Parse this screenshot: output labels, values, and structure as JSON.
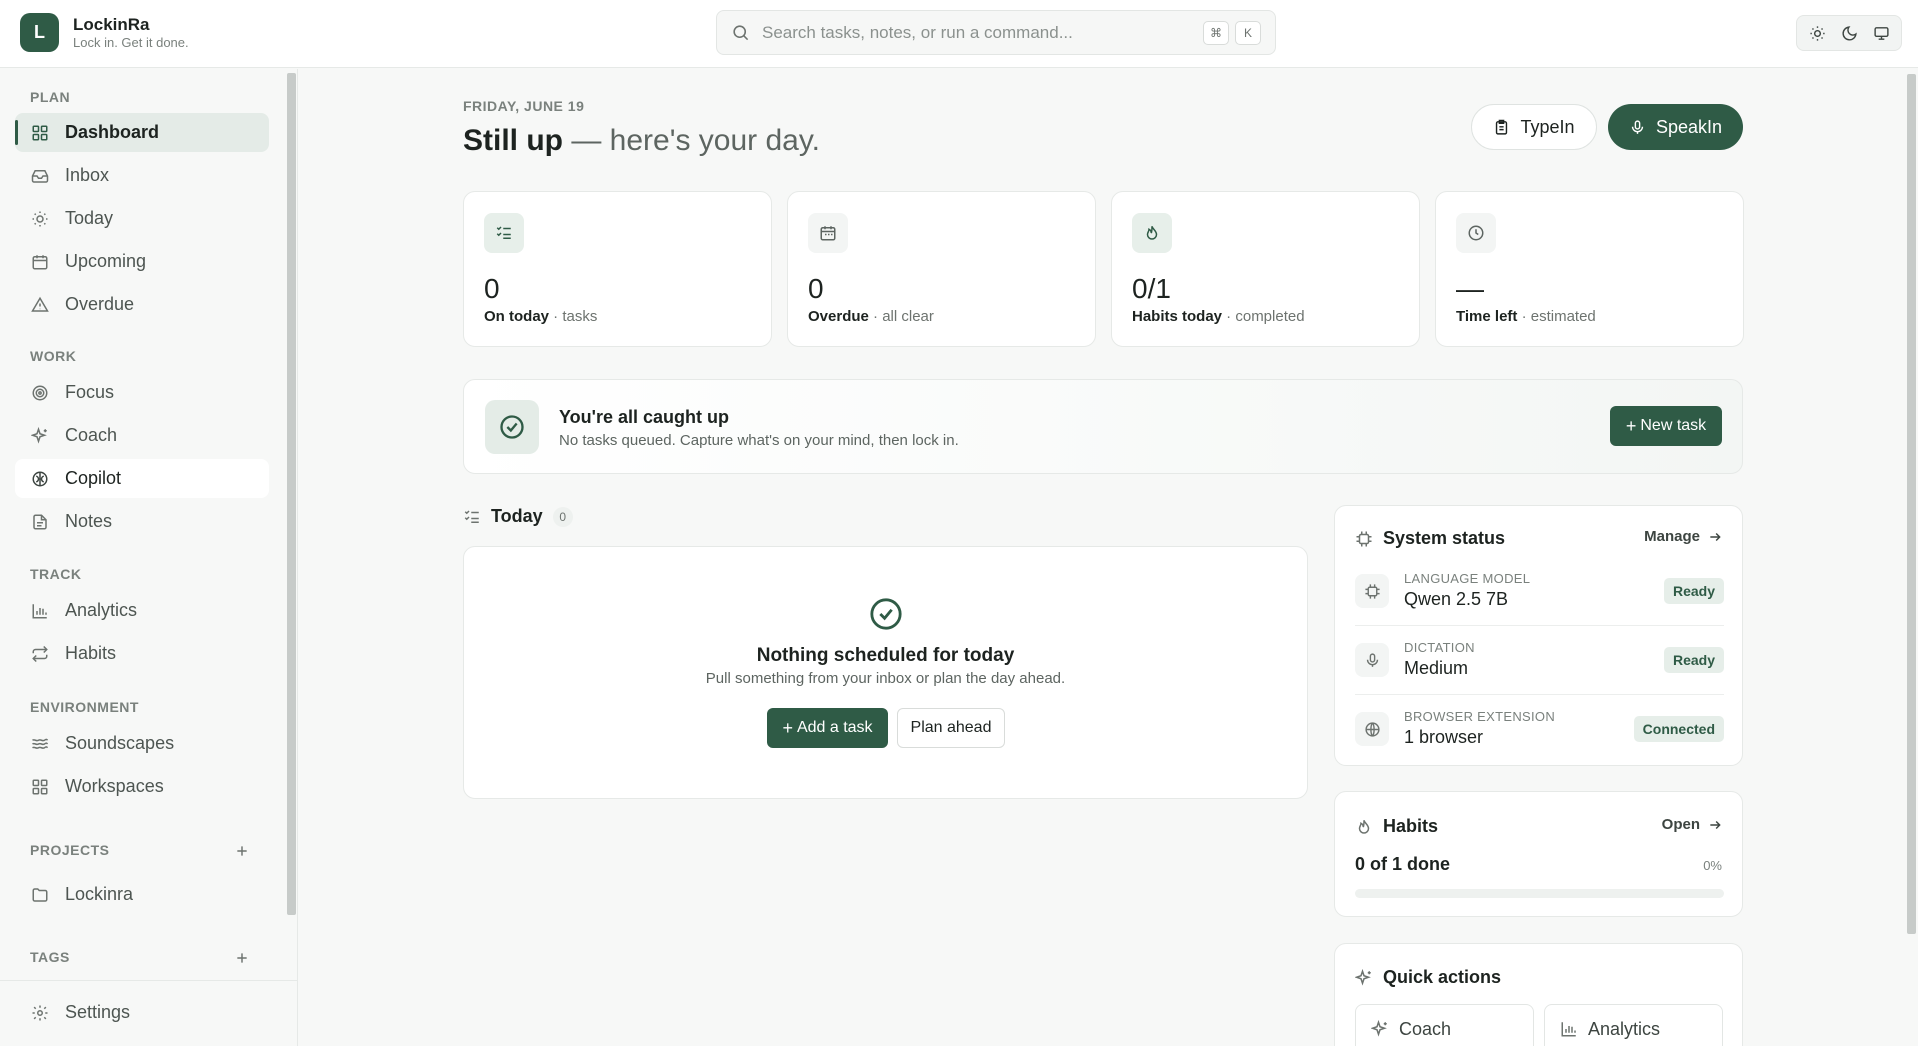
{
  "brand": {
    "logo_letter": "L",
    "name": "LockinRa",
    "tagline": "Lock in. Get it done."
  },
  "search": {
    "placeholder": "Search tasks, notes, or run a command...",
    "kbd1": "⌘",
    "kbd2": "K"
  },
  "theme_options": [
    "light",
    "dark",
    "system"
  ],
  "sidebar": {
    "sections": {
      "plan": "PLAN",
      "work": "WORK",
      "track": "TRACK",
      "environment": "ENVIRONMENT",
      "projects": "PROJECTS",
      "tags": "TAGS"
    },
    "plan_items": [
      {
        "label": "Dashboard",
        "icon": "grid-icon",
        "active": true
      },
      {
        "label": "Inbox",
        "icon": "inbox-icon"
      },
      {
        "label": "Today",
        "icon": "sun-icon"
      },
      {
        "label": "Upcoming",
        "icon": "calendar-icon"
      },
      {
        "label": "Overdue",
        "icon": "warning-icon"
      }
    ],
    "work_items": [
      {
        "label": "Focus",
        "icon": "target-icon"
      },
      {
        "label": "Coach",
        "icon": "sparkles-icon"
      },
      {
        "label": "Copilot",
        "icon": "brain-icon",
        "hover": true
      },
      {
        "label": "Notes",
        "icon": "document-icon"
      }
    ],
    "track_items": [
      {
        "label": "Analytics",
        "icon": "bar-chart-icon"
      },
      {
        "label": "Habits",
        "icon": "repeat-icon"
      }
    ],
    "environment_items": [
      {
        "label": "Soundscapes",
        "icon": "waves-icon"
      },
      {
        "label": "Workspaces",
        "icon": "grid-icon"
      }
    ],
    "projects": [
      {
        "label": "Lockinra",
        "icon": "folder-icon"
      }
    ],
    "settings_label": "Settings"
  },
  "main": {
    "date": "FRIDAY, JUNE 19",
    "greeting_bold": "Still up",
    "greeting_rest": " — here's your day.",
    "typein_label": "TypeIn",
    "speakin_label": "SpeakIn",
    "stats": [
      {
        "value": "0",
        "label": "On today",
        "sub": " · tasks",
        "icon": "checklist-icon"
      },
      {
        "value": "0",
        "label": "Overdue",
        "sub": " · all clear",
        "icon": "calendar-icon"
      },
      {
        "value": "0/1",
        "label": "Habits today",
        "sub": " · completed",
        "icon": "flame-icon"
      },
      {
        "value": "—",
        "label": "Time left",
        "sub": " · estimated",
        "icon": "clock-icon"
      }
    ],
    "caught_up": {
      "title": "You're all caught up",
      "subtitle": "No tasks queued. Capture what's on your mind, then lock in.",
      "button": "New task"
    },
    "today": {
      "title": "Today",
      "count": "0",
      "empty_title": "Nothing scheduled for today",
      "empty_sub": "Pull something from your inbox or plan the day ahead.",
      "add_button": "Add a task",
      "plan_button": "Plan ahead"
    }
  },
  "system_status": {
    "title": "System status",
    "link": "Manage",
    "rows": [
      {
        "label": "LANGUAGE MODEL",
        "value": "Qwen 2.5 7B",
        "badge": "Ready",
        "icon": "chip-icon"
      },
      {
        "label": "DICTATION",
        "value": "Medium",
        "badge": "Ready",
        "icon": "microphone-icon"
      },
      {
        "label": "BROWSER EXTENSION",
        "value": "1 browser",
        "badge": "Connected",
        "icon": "globe-icon"
      }
    ]
  },
  "habits_card": {
    "title": "Habits",
    "link": "Open",
    "summary": "0 of 1 done",
    "percent": "0%",
    "progress": 0
  },
  "quick_actions": {
    "title": "Quick actions",
    "items": [
      {
        "label": "Coach"
      },
      {
        "label": "Analytics"
      }
    ]
  },
  "colors": {
    "accent": "#2f5b46",
    "accent_soft": "#e4ebe7",
    "background": "#f7f8f7"
  }
}
